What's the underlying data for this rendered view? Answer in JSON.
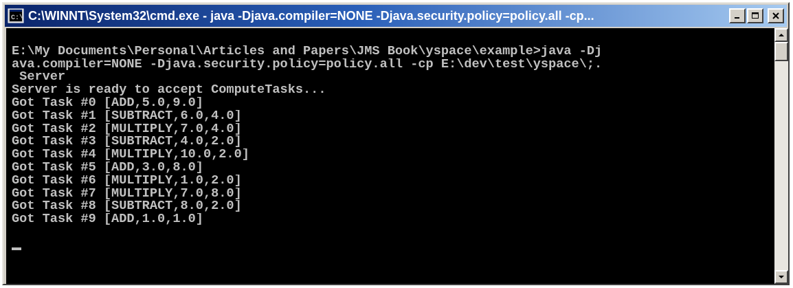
{
  "window": {
    "title": "C:\\WINNT\\System32\\cmd.exe - java -Djava.compiler=NONE -Djava.security.policy=policy.all -cp..."
  },
  "console": {
    "lines": [
      "",
      "E:\\My Documents\\Personal\\Articles and Papers\\JMS Book\\yspace\\example>java -Dj",
      "ava.compiler=NONE -Djava.security.policy=policy.all -cp E:\\dev\\test\\yspace\\;.",
      " Server",
      "Server is ready to accept ComputeTasks...",
      "Got Task #0 [ADD,5.0,9.0]",
      "Got Task #1 [SUBTRACT,6.0,4.0]",
      "Got Task #2 [MULTIPLY,7.0,4.0]",
      "Got Task #3 [SUBTRACT,4.0,2.0]",
      "Got Task #4 [MULTIPLY,10.0,2.0]",
      "Got Task #5 [ADD,3.0,8.0]",
      "Got Task #6 [MULTIPLY,1.0,2.0]",
      "Got Task #7 [MULTIPLY,7.0,8.0]",
      "Got Task #8 [SUBTRACT,8.0,2.0]",
      "Got Task #9 [ADD,1.0,1.0]"
    ]
  },
  "icons": {
    "app": "command-prompt-icon",
    "minimize": "minimize-icon",
    "maximize": "maximize-icon",
    "close": "close-icon",
    "scroll_up": "arrow-up-icon",
    "scroll_down": "arrow-down-icon"
  },
  "colors": {
    "titlebar_start": "#0a246a",
    "titlebar_end": "#a6caf0",
    "console_bg": "#000000",
    "console_text": "#c0c0c0",
    "chrome": "#d4d0c8"
  }
}
